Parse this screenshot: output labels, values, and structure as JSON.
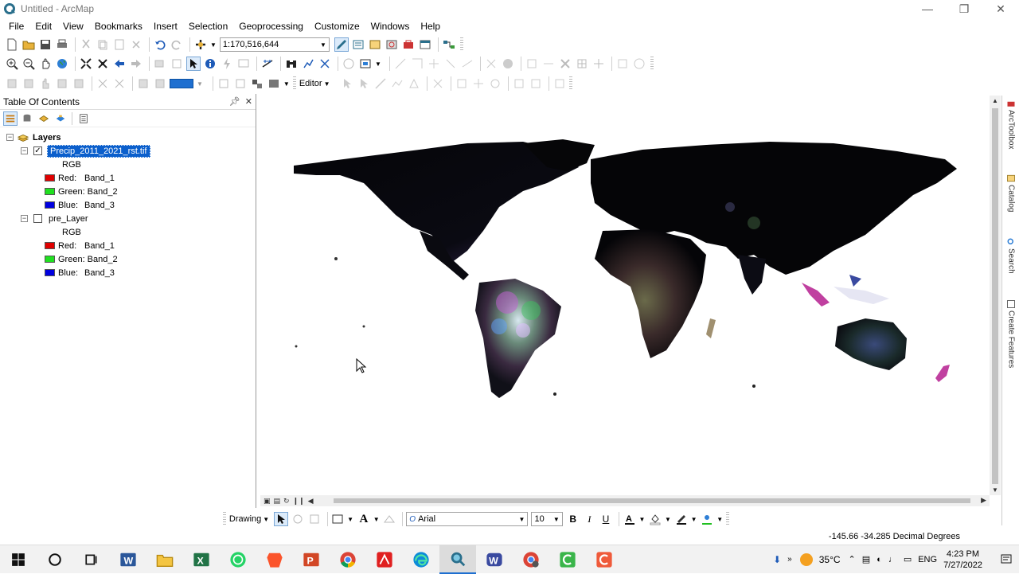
{
  "window": {
    "title": "Untitled - ArcMap"
  },
  "menu": [
    "File",
    "Edit",
    "View",
    "Bookmarks",
    "Insert",
    "Selection",
    "Geoprocessing",
    "Customize",
    "Windows",
    "Help"
  ],
  "standard_toolbar": {
    "scale": "1:170,516,644"
  },
  "editor_toolbar": {
    "editor_label": "Editor"
  },
  "toc": {
    "title": "Table Of Contents",
    "root": "Layers",
    "layers": [
      {
        "name": "Precip_2011_2021_rst.tif",
        "checked": true,
        "renderer": "RGB",
        "bands": [
          {
            "channel": "Red:",
            "band": "Band_1",
            "color": "#ff0000"
          },
          {
            "channel": "Green:",
            "band": "Band_2",
            "color": "#00e000"
          },
          {
            "channel": "Blue:",
            "band": "Band_3",
            "color": "#0000ff"
          }
        ]
      },
      {
        "name": "pre_Layer",
        "checked": false,
        "renderer": "RGB",
        "bands": [
          {
            "channel": "Red:",
            "band": "Band_1",
            "color": "#ff0000"
          },
          {
            "channel": "Green:",
            "band": "Band_2",
            "color": "#00e000"
          },
          {
            "channel": "Blue:",
            "band": "Band_3",
            "color": "#0000ff"
          }
        ]
      }
    ]
  },
  "right_dock": [
    "ArcToolbox",
    "Catalog",
    "Search",
    "Create Features"
  ],
  "drawing_toolbar": {
    "label": "Drawing",
    "font": "Arial",
    "size": "10",
    "bold": "B",
    "italic": "I",
    "underline": "U"
  },
  "status": {
    "coords": "-145.66  -34.285 Decimal Degrees"
  },
  "taskbar": {
    "weather": "35°C",
    "lang": "ENG",
    "time": "4:23 PM",
    "date": "7/27/2022"
  }
}
